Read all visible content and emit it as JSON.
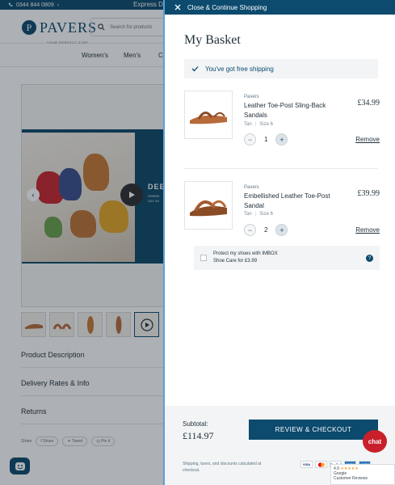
{
  "colors": {
    "brand": "#0c4a6e",
    "chat": "#c8202b",
    "accent_border": "#5aa0d8"
  },
  "background": {
    "topbar": {
      "phone": "0344 844 0809",
      "promo": "Express De"
    },
    "logo": {
      "word": "PAVERS",
      "tagline": "YOUR PERFECT STEP"
    },
    "search": {
      "placeholder": "Search for products"
    },
    "nav": [
      "Women's",
      "Men's",
      "C"
    ],
    "hero": {
      "headline": "DEE",
      "sub": "DEBBIE\nDAY WI"
    },
    "accordions": [
      "Product Description",
      "Delivery Rates & Info",
      "Returns"
    ],
    "share": {
      "label": "Share",
      "buttons": [
        "Share",
        "Tweet",
        "Pin it"
      ]
    }
  },
  "drawer": {
    "close_label": "Close & Continue Shopping",
    "title": "My Basket",
    "shipping_message": "You've got free shipping",
    "items": [
      {
        "brand": "Pavers",
        "name": "Leather Toe-Post Sling-Back Sandals",
        "colour": "Tan",
        "size": "Size 6",
        "qty": "1",
        "price": "£34.99",
        "remove": "Remove"
      },
      {
        "brand": "Pavers",
        "name": "Embellished Leather Toe-Post Sandal",
        "colour": "Tan",
        "size": "Size 6",
        "qty": "2",
        "price": "£39.99",
        "remove": "Remove"
      }
    ],
    "care": {
      "line1": "Protect my shoes with IMBOX",
      "line2": "Shoe Care for £3.99",
      "info": "?"
    },
    "footer": {
      "subtotal_label": "Subtotal:",
      "subtotal_value": "£114.97",
      "checkout_label": "REVIEW & CHECKOUT",
      "tax_note": "Shipping, taxes, and discounts calculated at checkout.",
      "payment_cards": [
        "VISA",
        "MC",
        "PayPal",
        "AMEX",
        "AMEX"
      ]
    }
  },
  "widgets": {
    "chat_label": "chat",
    "reviews": {
      "score": "4.9",
      "stars": "★★★★★",
      "line1": "Google",
      "line2": "Customer Reviews"
    }
  }
}
